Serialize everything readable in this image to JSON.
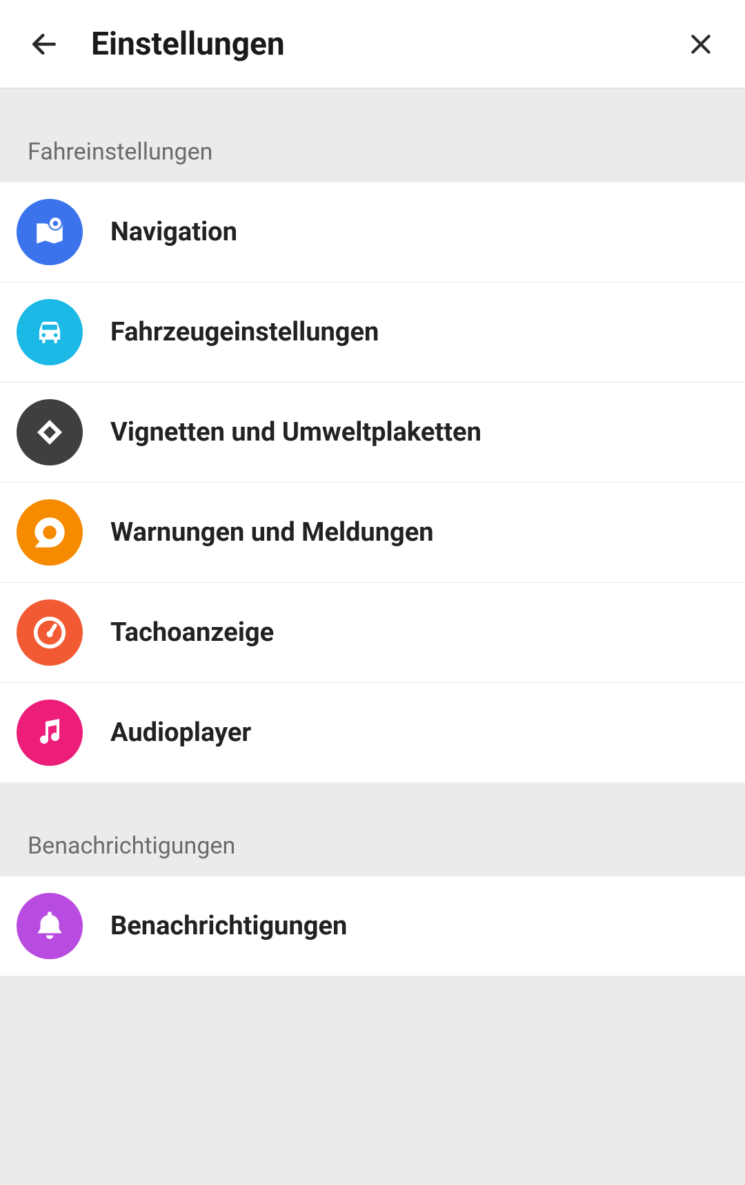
{
  "header": {
    "title": "Einstellungen"
  },
  "sections": [
    {
      "title": "Fahreinstellungen",
      "items": [
        {
          "label": "Navigation",
          "icon": "map-pin-icon",
          "color": "#3b73ed"
        },
        {
          "label": "Fahrzeugeinstellungen",
          "icon": "car-icon",
          "color": "#1cb9e6"
        },
        {
          "label": "Vignetten und Umweltplaketten",
          "icon": "diamond-icon",
          "color": "#3f3f3f"
        },
        {
          "label": "Warnungen und Meldungen",
          "icon": "alert-circle-icon",
          "color": "#f78b00"
        },
        {
          "label": "Tachoanzeige",
          "icon": "speedometer-icon",
          "color": "#f25a34"
        },
        {
          "label": "Audioplayer",
          "icon": "music-icon",
          "color": "#ec1e79"
        }
      ]
    },
    {
      "title": "Benachrichtigungen",
      "items": [
        {
          "label": "Benachrichtigungen",
          "icon": "bell-icon",
          "color": "#b94ce0"
        }
      ]
    }
  ]
}
